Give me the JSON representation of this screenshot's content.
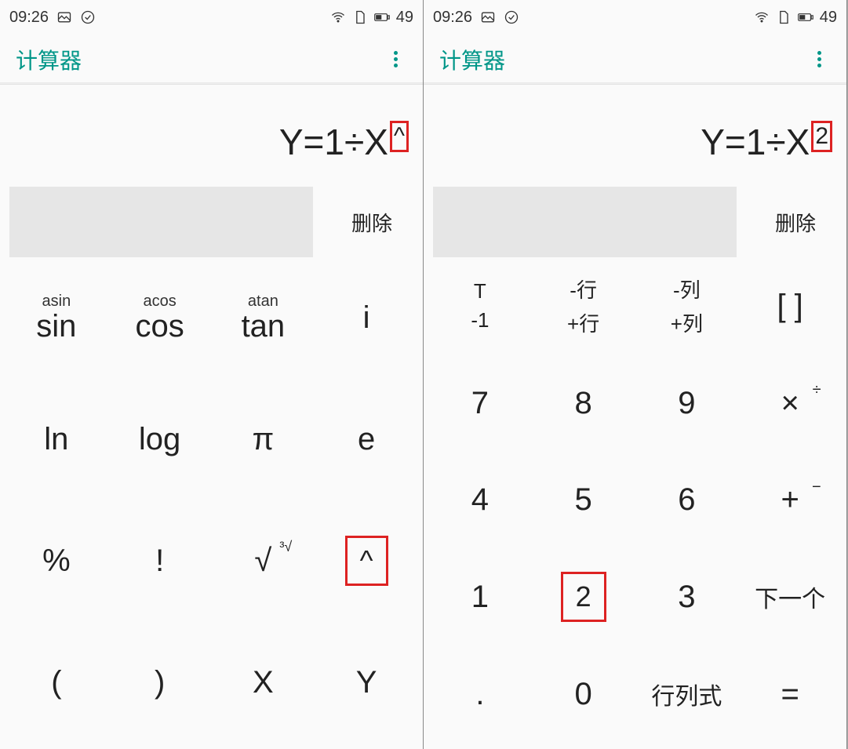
{
  "left": {
    "status": {
      "time": "09:26",
      "battery": "49"
    },
    "app_title": "计算器",
    "expression_main": "Y=1÷X",
    "expression_sup": "^",
    "delete_label": "删除",
    "keys": {
      "r0c0_sec": "asin",
      "r0c0": "sin",
      "r0c1_sec": "acos",
      "r0c1": "cos",
      "r0c2_sec": "atan",
      "r0c2": "tan",
      "r0c3": "i",
      "r1c0": "ln",
      "r1c1": "log",
      "r1c2": "π",
      "r1c3": "e",
      "r2c0": "%",
      "r2c1": "!",
      "r2c2": "√",
      "r2c2_sup": "³√",
      "r2c3": "^",
      "r3c0": "(",
      "r3c1": ")",
      "r3c2": "X",
      "r3c3": "Y"
    }
  },
  "right": {
    "status": {
      "time": "09:26",
      "battery": "49"
    },
    "app_title": "计算器",
    "expression_main": "Y=1÷X",
    "expression_sup": "2",
    "delete_label": "删除",
    "keys": {
      "r0c0a": "T",
      "r0c0b": "-1",
      "r0c1a": "-行",
      "r0c1b": "+行",
      "r0c2a": "-列",
      "r0c2b": "+列",
      "r0c3": "[ ]",
      "r1c0": "7",
      "r1c1": "8",
      "r1c2": "9",
      "r1c3": "×",
      "r1c3_sup": "÷",
      "r2c0": "4",
      "r2c1": "5",
      "r2c2": "6",
      "r2c3": "+",
      "r2c3_sup": "−",
      "r3c0": "1",
      "r3c1": "2",
      "r3c2": "3",
      "r3c3": "下一个",
      "r4c0": ".",
      "r4c1": "0",
      "r4c2": "行列式",
      "r4c3": "="
    }
  }
}
